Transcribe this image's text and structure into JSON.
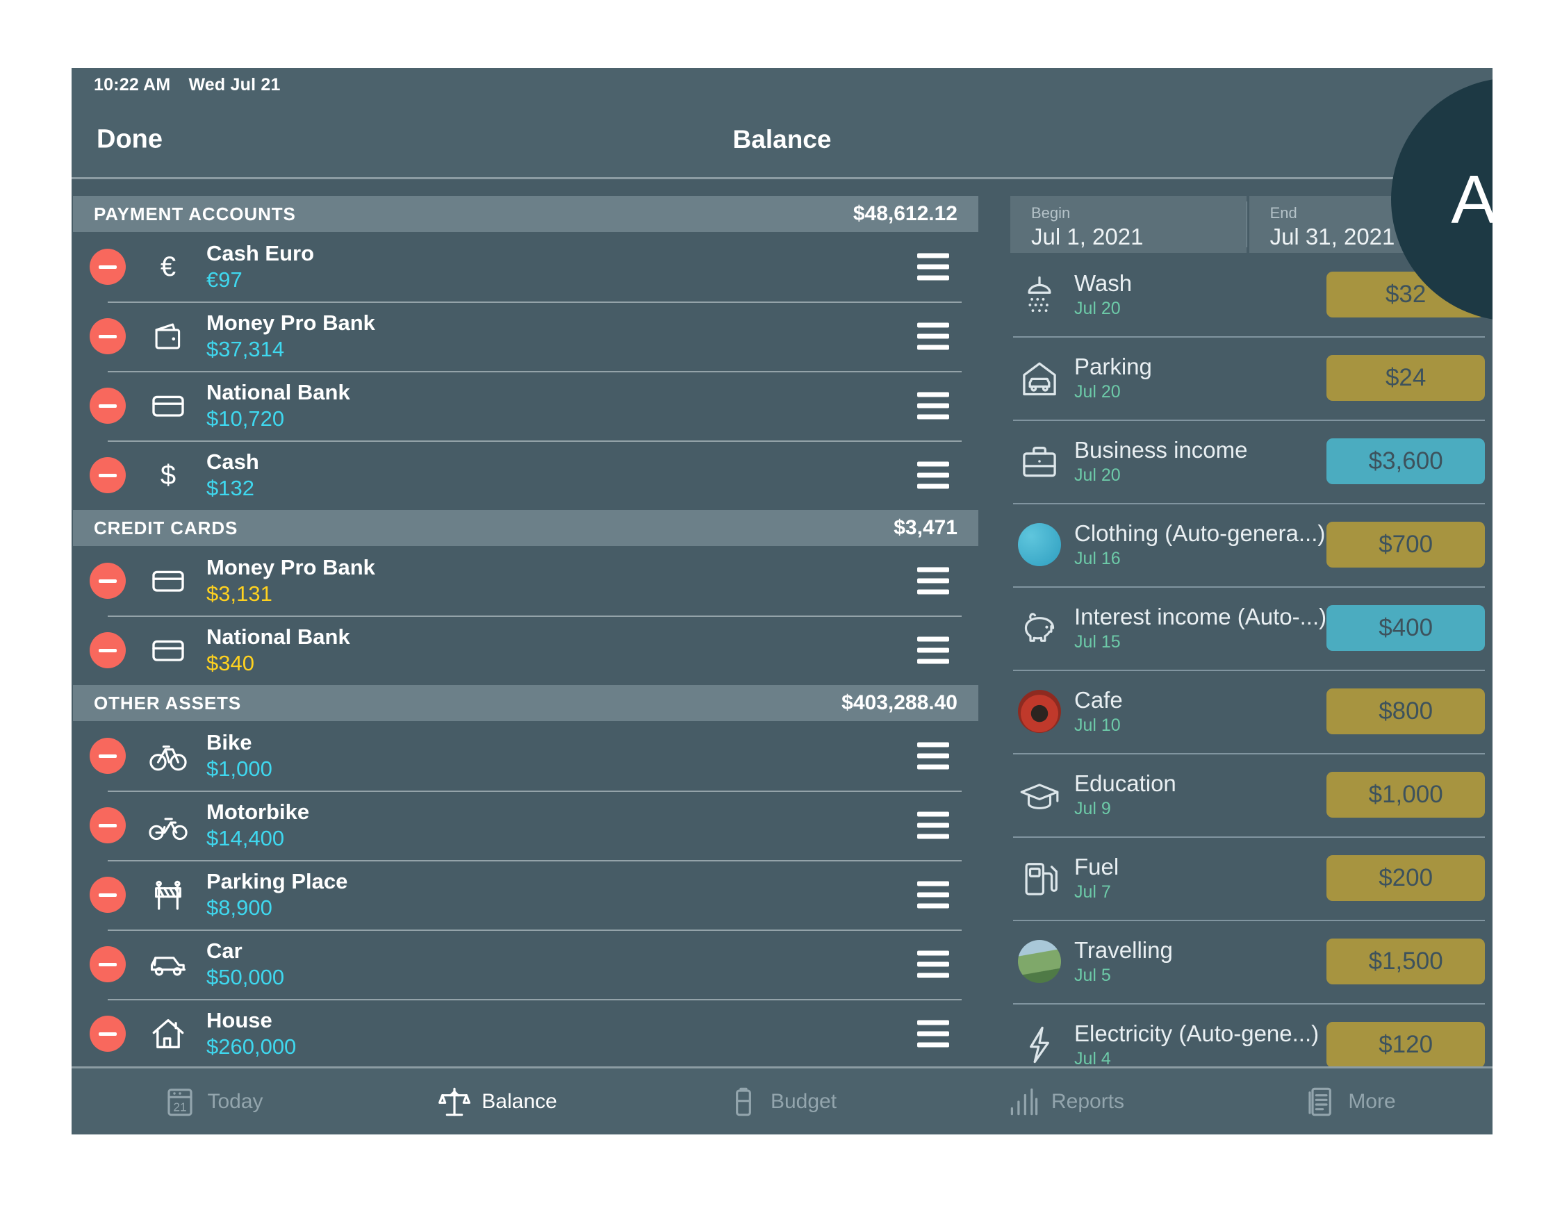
{
  "statusbar": {
    "time": "10:22 AM",
    "date": "Wed Jul 21"
  },
  "navbar": {
    "done_label": "Done",
    "title": "Balance"
  },
  "add_button": {
    "label": "Add",
    "color": "#1d3944"
  },
  "colors": {
    "app_bg": "#475c66",
    "bar_bg": "#4c626c",
    "section_header_bg": "#6c8089",
    "positive_amount": "#3fd8ef",
    "debt_amount": "#ffd21f",
    "minus_button": "#f8685d",
    "expense_badge": "#a79440",
    "income_badge": "#4bacc0",
    "tx_date": "#6dcaa8"
  },
  "sections": [
    {
      "title": "PAYMENT ACCOUNTS",
      "total": "$48,612.12",
      "rows": [
        {
          "name": "Cash Euro",
          "amount": "€97",
          "kind": "pos",
          "icon": "euro-icon"
        },
        {
          "name": "Money Pro Bank",
          "amount": "$37,314",
          "kind": "pos",
          "icon": "wallet-icon"
        },
        {
          "name": "National Bank",
          "amount": "$10,720",
          "kind": "pos",
          "icon": "credit-card-icon"
        },
        {
          "name": "Cash",
          "amount": "$132",
          "kind": "pos",
          "icon": "dollar-icon"
        }
      ]
    },
    {
      "title": "CREDIT CARDS",
      "total": "$3,471",
      "rows": [
        {
          "name": "Money Pro Bank",
          "amount": "$3,131",
          "kind": "debt",
          "icon": "credit-card-icon"
        },
        {
          "name": "National Bank",
          "amount": "$340",
          "kind": "debt",
          "icon": "credit-card-icon"
        }
      ]
    },
    {
      "title": "OTHER ASSETS",
      "total": "$403,288.40",
      "rows": [
        {
          "name": "Bike",
          "amount": "$1,000",
          "kind": "pos",
          "icon": "bicycle-icon"
        },
        {
          "name": "Motorbike",
          "amount": "$14,400",
          "kind": "pos",
          "icon": "motorbike-icon"
        },
        {
          "name": "Parking Place",
          "amount": "$8,900",
          "kind": "pos",
          "icon": "barrier-icon"
        },
        {
          "name": "Car",
          "amount": "$50,000",
          "kind": "pos",
          "icon": "car-icon"
        },
        {
          "name": "House",
          "amount": "$260,000",
          "kind": "pos",
          "icon": "house-icon"
        }
      ]
    }
  ],
  "date_range": {
    "begin_label": "Begin",
    "begin_value": "Jul 1, 2021",
    "end_label": "End",
    "end_value": "Jul 31, 2021"
  },
  "transactions": [
    {
      "name": "Wash",
      "date": "Jul 20",
      "amount": "$32",
      "type": "expense",
      "icon": "shower-icon"
    },
    {
      "name": "Parking",
      "date": "Jul 20",
      "amount": "$24",
      "type": "expense",
      "icon": "garage-icon"
    },
    {
      "name": "Business income",
      "date": "Jul 20",
      "amount": "$3,600",
      "type": "income",
      "icon": "briefcase-icon"
    },
    {
      "name": "Clothing (Auto-genera...)",
      "date": "Jul 16",
      "amount": "$700",
      "type": "expense",
      "icon": "clothing-photo-icon"
    },
    {
      "name": "Interest income (Auto-...)",
      "date": "Jul 15",
      "amount": "$400",
      "type": "income",
      "icon": "piggy-bank-icon"
    },
    {
      "name": "Cafe",
      "date": "Jul 10",
      "amount": "$800",
      "type": "expense",
      "icon": "coffee-photo-icon"
    },
    {
      "name": "Education",
      "date": "Jul 9",
      "amount": "$1,000",
      "type": "expense",
      "icon": "graduation-cap-icon"
    },
    {
      "name": "Fuel",
      "date": "Jul 7",
      "amount": "$200",
      "type": "expense",
      "icon": "fuel-pump-icon"
    },
    {
      "name": "Travelling",
      "date": "Jul 5",
      "amount": "$1,500",
      "type": "expense",
      "icon": "travel-photo-icon"
    },
    {
      "name": "Electricity (Auto-gene...)",
      "date": "Jul 4",
      "amount": "$120",
      "type": "expense",
      "icon": "lightning-icon"
    }
  ],
  "tabs": [
    {
      "label": "Today",
      "icon": "calendar-icon",
      "active": false
    },
    {
      "label": "Balance",
      "icon": "scales-icon",
      "active": true
    },
    {
      "label": "Budget",
      "icon": "battery-icon",
      "active": false
    },
    {
      "label": "Reports",
      "icon": "bar-chart-icon",
      "active": false
    },
    {
      "label": "More",
      "icon": "list-icon",
      "active": false
    }
  ]
}
